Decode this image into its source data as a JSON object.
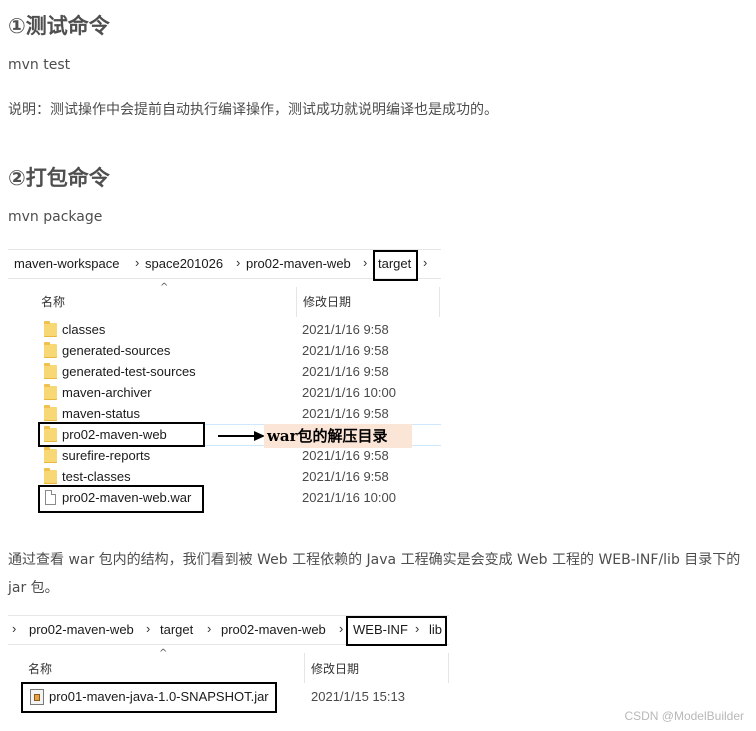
{
  "section1": {
    "heading": "①测试命令",
    "command": "mvn test",
    "note": "说明：测试操作中会提前自动执行编译操作，测试成功就说明编译也是成功的。"
  },
  "section2": {
    "heading": "②打包命令",
    "command": "mvn package"
  },
  "explorer1": {
    "breadcrumbs": [
      "maven-workspace",
      "space201026",
      "pro02-maven-web",
      "target"
    ],
    "columns": {
      "name": "名称",
      "date": "修改日期"
    },
    "rows": [
      {
        "name": "classes",
        "date": "2021/1/16 9:58",
        "icon": "folder-icon"
      },
      {
        "name": "generated-sources",
        "date": "2021/1/16 9:58",
        "icon": "folder-icon"
      },
      {
        "name": "generated-test-sources",
        "date": "2021/1/16 9:58",
        "icon": "folder-icon"
      },
      {
        "name": "maven-archiver",
        "date": "2021/1/16 10:00",
        "icon": "folder-icon"
      },
      {
        "name": "maven-status",
        "date": "2021/1/16 9:58",
        "icon": "folder-icon"
      },
      {
        "name": "pro02-maven-web",
        "date": "",
        "icon": "folder-icon"
      },
      {
        "name": "surefire-reports",
        "date": "2021/1/16 9:58",
        "icon": "folder-icon"
      },
      {
        "name": "test-classes",
        "date": "2021/1/16 9:58",
        "icon": "folder-icon"
      },
      {
        "name": "pro02-maven-web.war",
        "date": "2021/1/16 10:00",
        "icon": "file-icon"
      }
    ],
    "annotation": "war包的解压目录"
  },
  "explanation": "通过查看 war 包内的结构，我们看到被 Web 工程依赖的 Java 工程确实是会变成 Web 工程的 WEB-INF/lib 目录下的 jar 包。",
  "explorer2": {
    "breadcrumbs": [
      "pro02-maven-web",
      "target",
      "pro02-maven-web",
      "WEB-INF",
      "lib"
    ],
    "columns": {
      "name": "名称",
      "date": "修改日期"
    },
    "rows": [
      {
        "name": "pro01-maven-java-1.0-SNAPSHOT.jar",
        "date": "2021/1/15 15:13",
        "icon": "jar-file-icon"
      }
    ]
  },
  "watermark": "CSDN @ModelBuilder"
}
